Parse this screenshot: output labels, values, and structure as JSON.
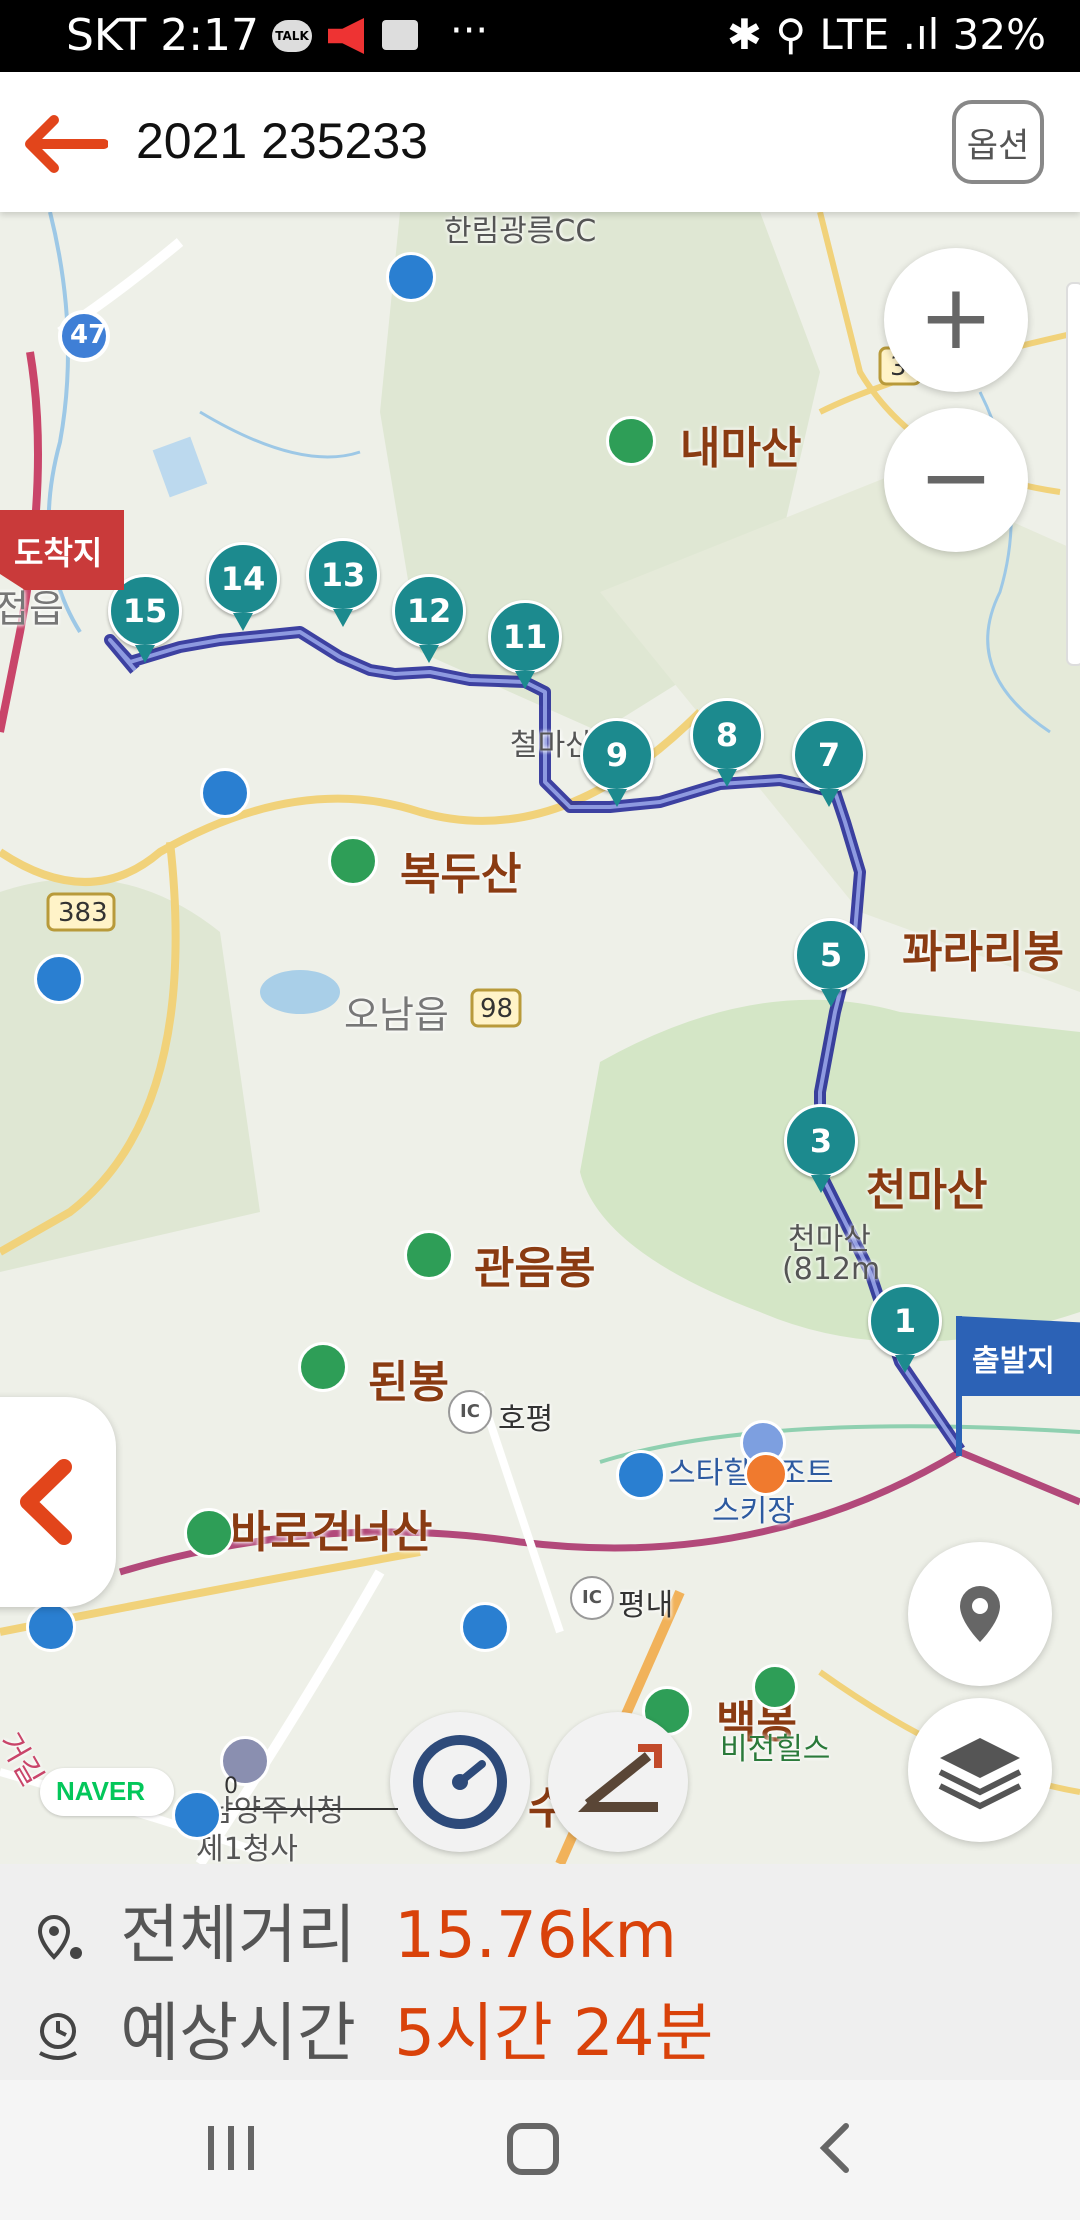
{
  "status_bar": {
    "carrier_time": "SKT 2:17",
    "icons_right": "✱ ⚲ LTE .ıl 32%",
    "talk_badge": "TALK",
    "more_dots": "···"
  },
  "header": {
    "title": "2021 235233",
    "option_label": "옵션"
  },
  "map": {
    "places": {
      "namsan_cc": "한림광릉CC",
      "naemasan": "내마산",
      "arrival": "도착지",
      "jeopeup": "접읍",
      "cheolmasan": "철마산",
      "bokdusan": "복두산",
      "kkararibong": "꽈라리봉",
      "onameup": "오남읍",
      "cheonmasan": "천마산",
      "cheonmasan_small": "천마산",
      "cheonmasan_alt": "(812m",
      "gwaneumbong": "관음봉",
      "doenbong": "된봉",
      "departure": "출발지",
      "hopyeong": "호평",
      "pyeongnae": "평내",
      "style_resort": "스타힐리조트",
      "ski": "스키장",
      "barogeonneosan": "바로건너산",
      "baekbong": "백봉",
      "vision_hills": "비전힐스",
      "city_hall": "남양주시청",
      "city_hall2": "제1청사",
      "road_47": "47",
      "road_383": "383",
      "road_98": "98",
      "road_3": "3",
      "ic": "IC",
      "naver": "NAVER",
      "scale_zero": "0",
      "partial_su": "수",
      "partial_gil": "거길"
    },
    "waypoints": [
      "15",
      "14",
      "13",
      "12",
      "11",
      "9",
      "8",
      "7",
      "5",
      "3",
      "1"
    ],
    "zoom_in": "+",
    "zoom_out": "−",
    "icons": {
      "back": "back-arrow-icon",
      "zoom_in": "plus-icon",
      "zoom_out": "minus-icon",
      "location": "location-pin-icon",
      "layers": "layers-icon",
      "collapse": "chevron-left-icon",
      "speed": "speedometer-icon",
      "elevation": "elevation-icon"
    }
  },
  "summary": {
    "distance_label": "전체거리",
    "distance_value": "15.76km",
    "time_label": "예상시간",
    "time_value": "5시간 24분"
  },
  "colors": {
    "accent": "#d9420a",
    "route": "#3a3fa8",
    "marker": "#1c8a8e",
    "arrival_flag": "#c93a3a",
    "departure_flag": "#2c62b6"
  }
}
